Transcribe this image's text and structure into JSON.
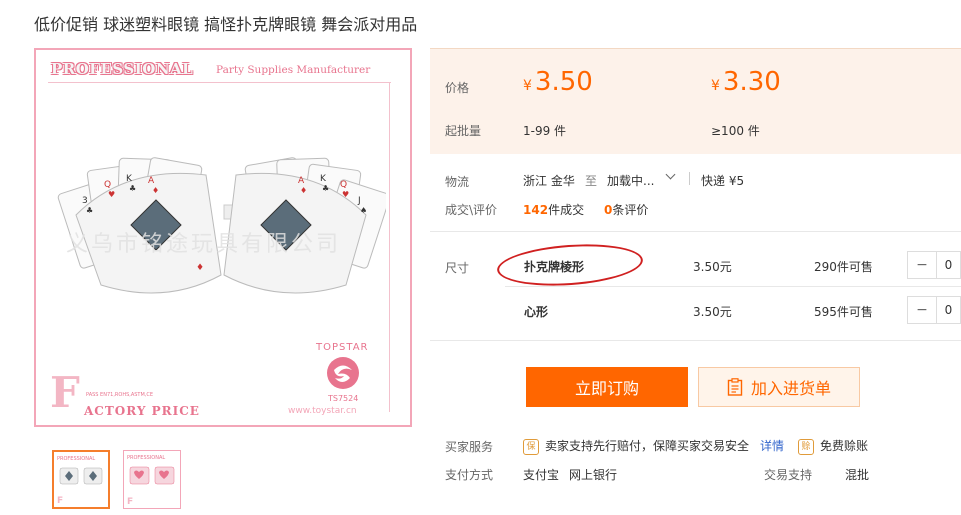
{
  "title": "低价促销 球迷塑料眼镜 搞怪扑克牌眼镜 舞会派对用品",
  "product_image": {
    "header_brand": "PROFESSIONAL",
    "header_sub": "Party Supplies Manufacturer",
    "watermark": "义乌市铭途玩具有限公司",
    "big_letter": "F",
    "footer": "ACTORY PRICE",
    "pass_text": "PASS EN71,ROHS,ASTM,CE",
    "logo_text": "TOPSTAR",
    "model": "TS7524",
    "url": "www.toystar.cn"
  },
  "price": {
    "label": "价格",
    "currency": "¥",
    "tier1_price": "3.50",
    "tier2_price": "3.30",
    "moq_label": "起批量",
    "tier1_range": "1-99 件",
    "tier2_range": "≥100 件"
  },
  "logistics": {
    "label": "物流",
    "from": "浙江 金华",
    "to_word": "至",
    "dest": "加载中...",
    "express": "快递 ¥5"
  },
  "deals": {
    "label": "成交\\评价",
    "count": "142",
    "count_suffix": "件成交",
    "reviews": "0",
    "reviews_suffix": "条评价"
  },
  "sizes": {
    "label": "尺寸",
    "items": [
      {
        "name": "扑克牌棱形",
        "price": "3.50元",
        "stock": "290件可售",
        "qty": "0"
      },
      {
        "name": "心形",
        "price": "3.50元",
        "stock": "595件可售",
        "qty": "0"
      }
    ]
  },
  "buttons": {
    "order": "立即订购",
    "cart": "加入进货单"
  },
  "service": {
    "label": "买家服务",
    "guarantee": "卖家支持先行赔付，保障买家交易安全",
    "detail_link": "详情",
    "free_icon": "赊",
    "free": "免费赊账",
    "guarantee_icon": "保"
  },
  "payment": {
    "label": "支付方式",
    "methods": [
      "支付宝",
      "网上银行"
    ],
    "trade_label": "交易支持",
    "trade_value": "混批"
  },
  "colors": {
    "accent": "#ff6600",
    "price_bg": "#fdf2ea",
    "link": "#3366cc",
    "pink": "#e8748e"
  }
}
